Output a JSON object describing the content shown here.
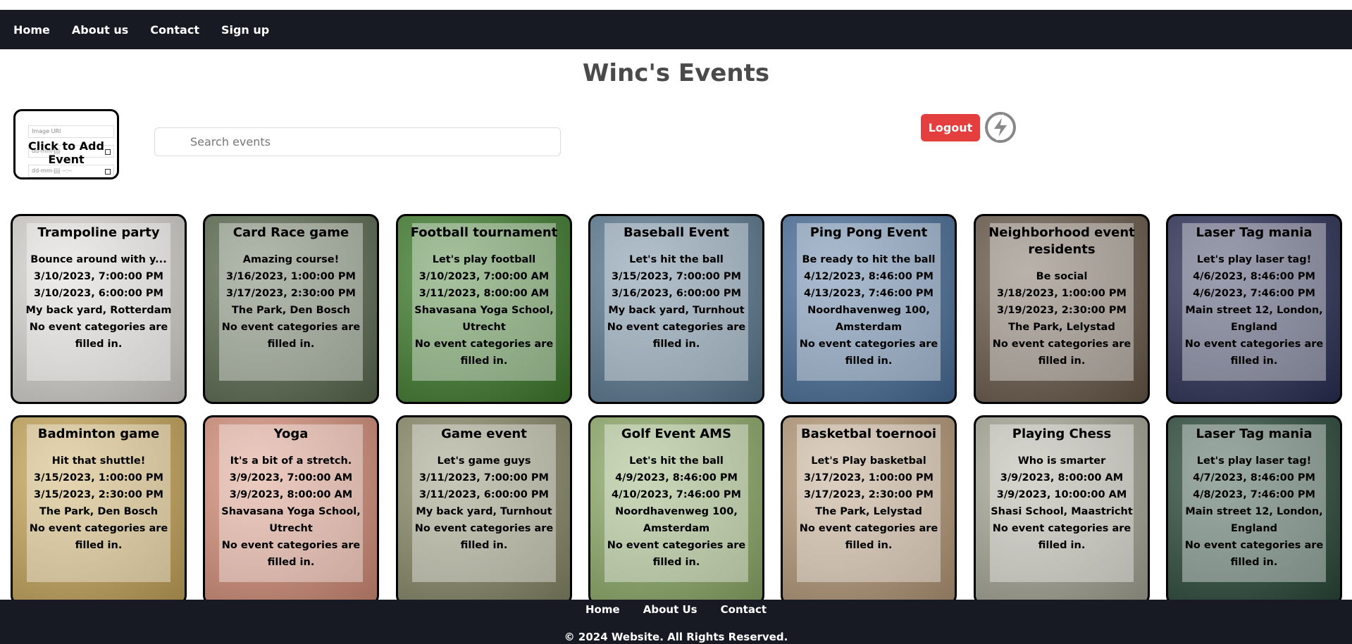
{
  "nav": {
    "items": [
      "Home",
      "About us",
      "Contact",
      "Sign up"
    ]
  },
  "page": {
    "title": "Winc's Events"
  },
  "add_event": {
    "label": "Click to Add Event",
    "image_placeholder": "Image URI",
    "date_placeholder": "dd-mm-jjjj",
    "datetime_placeholder": "dd-mm-jjjj --:--"
  },
  "search": {
    "placeholder": "Search events"
  },
  "logout": {
    "label": "Logout"
  },
  "events": [
    {
      "title": "Trampoline party",
      "lines": [
        "Bounce around with y...",
        "3/10/2023, 7:00:00 PM",
        "3/10/2023, 6:00:00 PM",
        "My back yard, Rotterdam",
        "No event categories are filled in."
      ],
      "bg": "#d9d6d2"
    },
    {
      "title": "Card Race game",
      "lines": [
        "Amazing course!",
        "3/16/2023, 1:00:00 PM",
        "3/17/2023, 2:30:00 PM",
        "The Park, Den Bosch",
        "No event categories are filled in."
      ],
      "bg": "#5c6b50"
    },
    {
      "title": "Football tournament",
      "lines": [
        "Let's play football",
        "3/10/2023, 7:00:00 AM",
        "3/11/2023, 8:00:00 AM",
        "Shavasana Yoga School, Utrecht",
        "No event categories are filled in."
      ],
      "bg": "#3f7d2e"
    },
    {
      "title": "Baseball Event",
      "lines": [
        "Let's hit the ball",
        "3/15/2023, 7:00:00 PM",
        "3/16/2023, 6:00:00 PM",
        "My back yard, Turnhout",
        "No event categories are filled in."
      ],
      "bg": "#5b7a93"
    },
    {
      "title": "Ping Pong Event",
      "lines": [
        "Be ready to hit the ball",
        "4/12/2023, 8:46:00 PM",
        "4/13/2023, 7:46:00 PM",
        "Noordhavenweg 100, Amsterdam",
        "No event categories are filled in."
      ],
      "bg": "#4a6f9a"
    },
    {
      "title": "Neighborhood event residents",
      "lines": [
        "Be social",
        "3/18/2023, 1:00:00 PM",
        "3/19/2023, 2:30:00 PM",
        "The Park, Lelystad",
        "No event categories are filled in."
      ],
      "bg": "#6a5a4a"
    },
    {
      "title": "Laser Tag mania",
      "lines": [
        "Let's play laser tag!",
        "4/6/2023, 8:46:00 PM",
        "4/6/2023, 7:46:00 PM",
        "Main street 12, London, England",
        "No event categories are filled in."
      ],
      "bg": "#2a2f55"
    },
    {
      "title": "Badminton game",
      "lines": [
        "Hit that shuttle!",
        "3/15/2023, 1:00:00 PM",
        "3/15/2023, 2:30:00 PM",
        "The Park, Den Bosch",
        "No event categories are filled in."
      ],
      "bg": "#c9a85a"
    },
    {
      "title": "Yoga",
      "lines": [
        "It's a bit of a stretch.",
        "3/9/2023, 7:00:00 AM",
        "3/9/2023, 8:00:00 AM",
        "Shavasana Yoga School, Utrecht",
        "No event categories are filled in."
      ],
      "bg": "#d8907a"
    },
    {
      "title": "Game event",
      "lines": [
        "Let's game guys",
        "3/11/2023, 7:00:00 PM",
        "3/11/2023, 6:00:00 PM",
        "My back yard, Turnhout",
        "No event categories are filled in."
      ],
      "bg": "#8a8a6a"
    },
    {
      "title": "Golf Event AMS",
      "lines": [
        "Let's hit the ball",
        "4/9/2023, 8:46:00 PM",
        "4/10/2023, 7:46:00 PM",
        "Noordhavenweg 100, Amsterdam",
        "No event categories are filled in."
      ],
      "bg": "#8fae6a"
    },
    {
      "title": "Basketbal toernooi",
      "lines": [
        "Let's Play basketbal",
        "3/17/2023, 1:00:00 PM",
        "3/17/2023, 2:30:00 PM",
        "The Park, Lelystad",
        "No event categories are filled in."
      ],
      "bg": "#b79a7a"
    },
    {
      "title": "Playing Chess",
      "lines": [
        "Who is smarter",
        "3/9/2023, 8:00:00 AM",
        "3/9/2023, 10:00:00 AM",
        "Shasi School, Maastricht",
        "No event categories are filled in."
      ],
      "bg": "#a8a898"
    },
    {
      "title": "Laser Tag mania",
      "lines": [
        "Let's play laser tag!",
        "4/7/2023, 8:46:00 PM",
        "4/8/2023, 7:46:00 PM",
        "Main street 12, London, England",
        "No event categories are filled in."
      ],
      "bg": "#2a4a3a"
    }
  ],
  "footer": {
    "links": [
      "Home",
      "About Us",
      "Contact"
    ],
    "copyright": "© 2024 Website. All Rights Reserved."
  }
}
